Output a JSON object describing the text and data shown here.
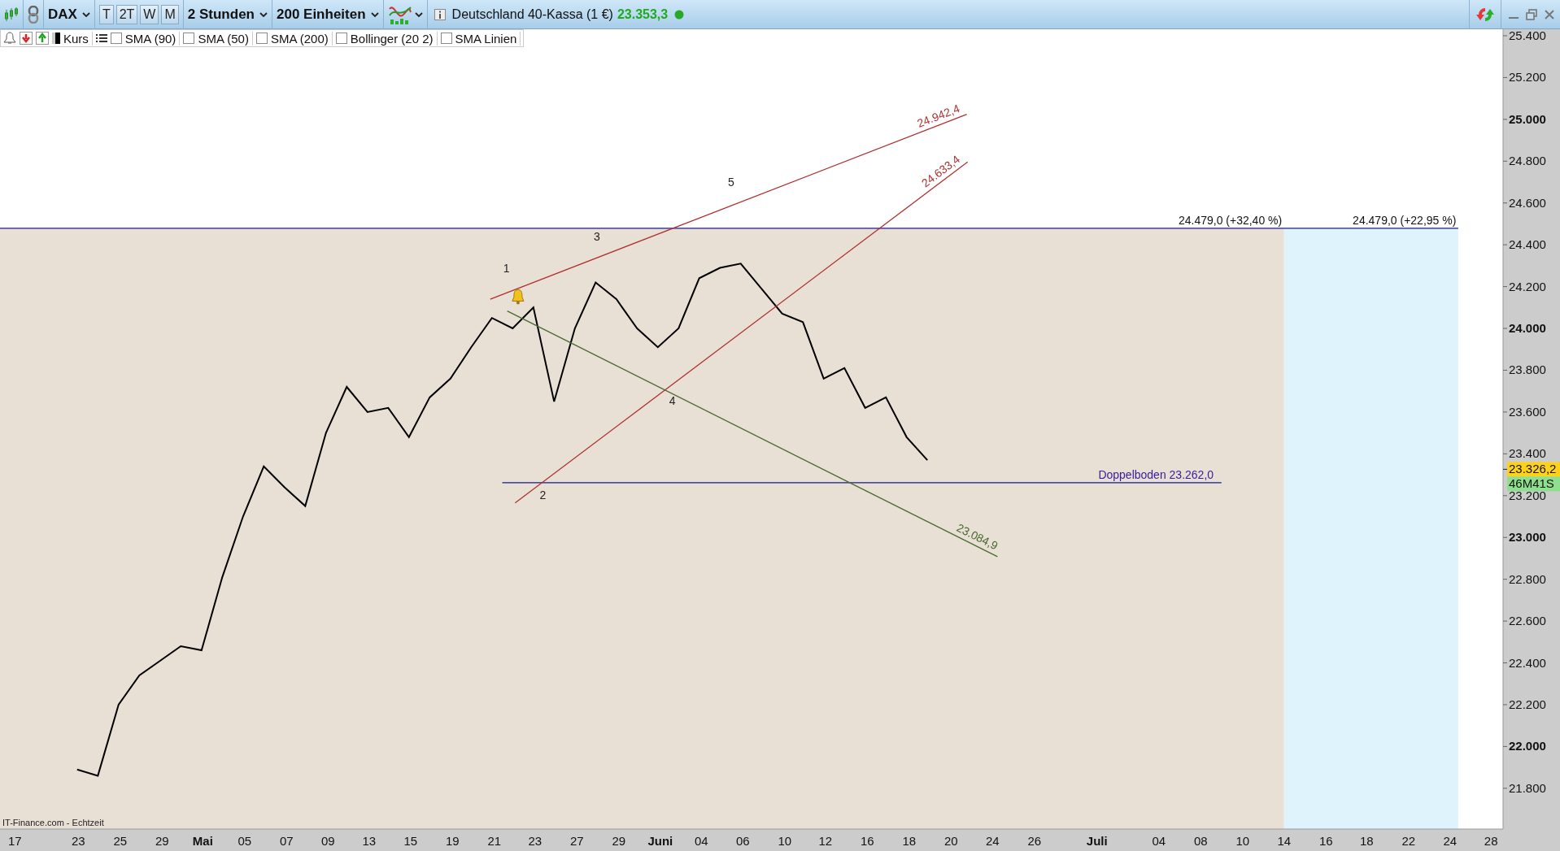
{
  "toolbar": {
    "symbol": "DAX",
    "period_buttons": [
      "T",
      "2T",
      "W",
      "M"
    ],
    "interval": "2 Stunden",
    "units": "200 Einheiten",
    "instrument": "Deutschland 40-Kassa (1 €)",
    "price": "23.353,3"
  },
  "legend": {
    "indicators": [
      {
        "label": "SMA (90)",
        "checked": false
      },
      {
        "label": "SMA (50)",
        "checked": false
      },
      {
        "label": "SMA (200)",
        "checked": false
      },
      {
        "label": "Bollinger (20 2)",
        "checked": false
      },
      {
        "label": "SMA Linien",
        "checked": false
      }
    ]
  },
  "chart": {
    "source": "IT-Finance.com - Echtzeit",
    "chart_data": {
      "type": "line",
      "ylim": [
        21605,
        25431
      ],
      "ref_lines": [
        {
          "axis": "y",
          "value": 24479,
          "color": "#1a1a8c"
        },
        {
          "axis": "y",
          "value": 23262,
          "color": "#1a1a8c"
        }
      ],
      "series": [
        {
          "name": "Kurs",
          "color": "#000000",
          "values": [
            21890,
            21860,
            22200,
            22340,
            22410,
            22480,
            22460,
            22810,
            23100,
            23340,
            23240,
            23150,
            23500,
            23720,
            23600,
            23620,
            23480,
            23670,
            23760,
            23910,
            24050,
            24000,
            24100,
            23650,
            24000,
            24220,
            24140,
            24000,
            23910,
            24000,
            24240,
            24290,
            24310,
            24190,
            24070,
            24030,
            23760,
            23810,
            23620,
            23670,
            23480,
            23370
          ]
        }
      ],
      "yticks": [
        {
          "value": 25400,
          "label": "25.400"
        },
        {
          "value": 25200,
          "label": "25.200"
        },
        {
          "value": 25000,
          "label": "25.000"
        },
        {
          "value": 24800,
          "label": "24.800"
        },
        {
          "value": 24600,
          "label": "24.600"
        },
        {
          "value": 24400,
          "label": "24.400"
        },
        {
          "value": 24200,
          "label": "24.200"
        },
        {
          "value": 24000,
          "label": "24.000"
        },
        {
          "value": 23800,
          "label": "23.800"
        },
        {
          "value": 23600,
          "label": "23.600"
        },
        {
          "value": 23400,
          "label": "23.400"
        },
        {
          "value": 23200,
          "label": "23.200"
        },
        {
          "value": 23000,
          "label": "23.000"
        },
        {
          "value": 22800,
          "label": "22.800"
        },
        {
          "value": 22600,
          "label": "22.600"
        },
        {
          "value": 22400,
          "label": "22.400"
        },
        {
          "value": 22200,
          "label": "22.200"
        },
        {
          "value": 22000,
          "label": "22.000"
        },
        {
          "value": 21800,
          "label": "21.800"
        }
      ]
    },
    "x_axis_labels": [
      {
        "label": "17",
        "kind": "day"
      },
      {
        "label": "23",
        "kind": "day"
      },
      {
        "label": "25",
        "kind": "day"
      },
      {
        "label": "29",
        "kind": "day"
      },
      {
        "label": "Mai",
        "kind": "month"
      },
      {
        "label": "05",
        "kind": "day"
      },
      {
        "label": "07",
        "kind": "day"
      },
      {
        "label": "09",
        "kind": "day"
      },
      {
        "label": "13",
        "kind": "day"
      },
      {
        "label": "15",
        "kind": "day"
      },
      {
        "label": "19",
        "kind": "day"
      },
      {
        "label": "21",
        "kind": "day"
      },
      {
        "label": "23",
        "kind": "day"
      },
      {
        "label": "27",
        "kind": "day"
      },
      {
        "label": "29",
        "kind": "day"
      },
      {
        "label": "Juni",
        "kind": "month"
      },
      {
        "label": "04",
        "kind": "day"
      },
      {
        "label": "06",
        "kind": "day"
      },
      {
        "label": "10",
        "kind": "day"
      },
      {
        "label": "12",
        "kind": "day"
      },
      {
        "label": "16",
        "kind": "day"
      },
      {
        "label": "18",
        "kind": "day"
      },
      {
        "label": "20",
        "kind": "day"
      },
      {
        "label": "24",
        "kind": "day"
      },
      {
        "label": "26",
        "kind": "day"
      },
      {
        "label": "Juli",
        "kind": "month"
      },
      {
        "label": "04",
        "kind": "day"
      },
      {
        "label": "08",
        "kind": "day"
      },
      {
        "label": "10",
        "kind": "day"
      },
      {
        "label": "14",
        "kind": "day"
      },
      {
        "label": "16",
        "kind": "day"
      },
      {
        "label": "18",
        "kind": "day"
      },
      {
        "label": "22",
        "kind": "day"
      },
      {
        "label": "24",
        "kind": "day"
      },
      {
        "label": "28",
        "kind": "day"
      }
    ],
    "level_lines": [
      {
        "labels": [
          "24.479,0 (+32,40 %)",
          "24.479,0 (+22,95 %)"
        ]
      },
      {
        "labels": [
          "Doppelboden 23.262,0"
        ]
      }
    ],
    "trend_lines": [
      {
        "label": "24.942,4",
        "color": "#b03030"
      },
      {
        "label": "24.633,4",
        "color": "#b03030"
      },
      {
        "label": "23.084,9",
        "color": "#4a6a30"
      }
    ],
    "wave_labels": [
      "1",
      "2",
      "3",
      "4",
      "5"
    ],
    "price_tag": "23.326,2",
    "countdown": "46M41S"
  }
}
